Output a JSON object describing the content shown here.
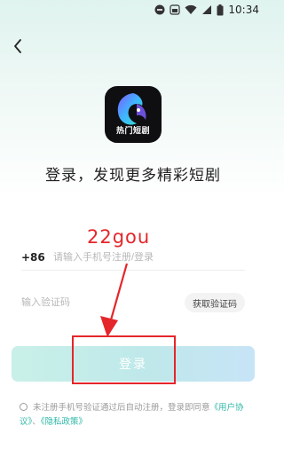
{
  "status_bar": {
    "time": "10:34"
  },
  "app": {
    "icon_label": "热门短剧"
  },
  "headline": "登录，发现更多精彩短剧",
  "phone": {
    "country_code": "+86",
    "placeholder": "请输入手机号注册/登录",
    "value": ""
  },
  "code": {
    "placeholder": "输入验证码",
    "get_code_label": "获取验证码",
    "value": ""
  },
  "login_label": "登录",
  "agreement": {
    "text": "未注册手机号验证通过后自动注册，登录即同意",
    "user_agreement": "《用户协议》",
    "sep": "、",
    "privacy": "《隐私政策》"
  },
  "annotation": {
    "text": "22gou",
    "color": "#e5262a"
  },
  "colors": {
    "accent": "#2fb8a8",
    "login_gradient_start": "#c9f0e8",
    "login_gradient_end": "#c7e4f7"
  }
}
